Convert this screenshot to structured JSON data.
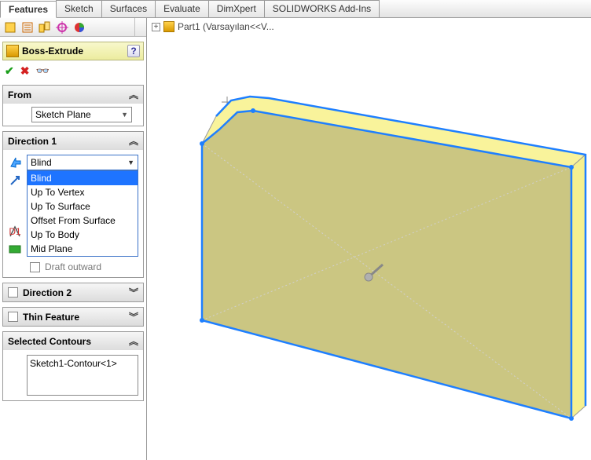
{
  "ribbon": {
    "tabs": [
      "Features",
      "Sketch",
      "Surfaces",
      "Evaluate",
      "DimXpert",
      "SOLIDWORKS Add-Ins"
    ],
    "active_index": 0
  },
  "feature": {
    "name": "Boss-Extrude",
    "help_glyph": "?"
  },
  "actions": {
    "ok_glyph": "✔",
    "cancel_glyph": "✖",
    "preview_glyph": "👓"
  },
  "sections": {
    "from": {
      "title": "From",
      "expand_glyph": "︽",
      "value": "Sketch Plane"
    },
    "direction1": {
      "title": "Direction 1",
      "expand_glyph": "︽",
      "combo_value": "Blind",
      "options": [
        "Blind",
        "Up To Vertex",
        "Up To Surface",
        "Offset From Surface",
        "Up To Body",
        "Mid Plane"
      ],
      "selected_index": 0,
      "draft_label": "Draft outward"
    },
    "direction2": {
      "title": "Direction 2",
      "collapse_glyph": "︾"
    },
    "thin": {
      "title": "Thin Feature",
      "collapse_glyph": "︾"
    },
    "contours": {
      "title": "Selected Contours",
      "expand_glyph": "︽",
      "items": [
        "Sketch1-Contour<1>"
      ]
    }
  },
  "breadcrumb": {
    "part_label": "Part1  (Varsayılan<<V..."
  }
}
